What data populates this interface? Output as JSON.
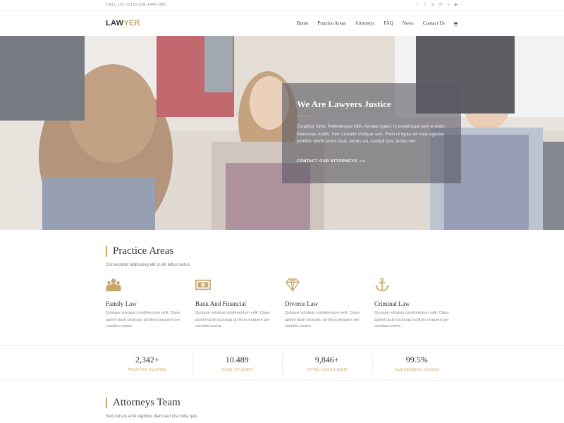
{
  "topbar": {
    "call": "CALL US: (212) 336-1440-356",
    "socials": [
      {
        "icon": "twitter-icon",
        "glyph": "t"
      },
      {
        "icon": "facebook-icon",
        "glyph": "f"
      },
      {
        "icon": "instagram-icon",
        "glyph": "◎"
      },
      {
        "icon": "linkedin-icon",
        "glyph": "in"
      },
      {
        "icon": "skype-icon",
        "glyph": "s"
      },
      {
        "icon": "youtube-icon",
        "glyph": "▶"
      }
    ]
  },
  "header": {
    "logo_part1": "LAW",
    "logo_part2": "YER",
    "nav": [
      "Home",
      "Practice Areas",
      "Attorneys",
      "FAQ",
      "News",
      "Contact Us"
    ],
    "menu_icon": "hamburger-menu-icon"
  },
  "hero": {
    "title": "We Are Lawyers Justice",
    "text": "Curabitur tortor. Pellentesque nibh. Aenean quam. In scelerisque sem at dolor. Maecenas mattis. Sed convallis tristique sem. Proin ut ligula vel nunc egestas porttitor. Morbi lectus risus, iaculis vel, suscipit quis, luctus non.",
    "cta": "CONTACT OUR ATTORNEYS",
    "cta_arrow": "⟶"
  },
  "practice": {
    "title": "Practice Areas",
    "subtitle": "Consectetur adipiscing elit ut elit tellus luctus",
    "items": [
      {
        "icon": "group-icon",
        "title": "Family Law",
        "text": "Quisque volutpat condimentum velit. Class aptent taciti sociosqu ad litora torquent per conubia nostra."
      },
      {
        "icon": "money-icon",
        "title": "Bank And Financial",
        "text": "Quisque volutpat condimentum velit. Class aptent taciti sociosqu ad litora torquent per conubia nostra."
      },
      {
        "icon": "diamond-icon",
        "title": "Divorce Law",
        "text": "Quisque volutpat condimentum velit. Class aptent taciti sociosqu ad litora torquent per conubia nostra."
      },
      {
        "icon": "anchor-icon",
        "title": "Criminal Law",
        "text": "Quisque volutpat condimentum velit. Class aptent taciti sociosqu ad litora torquent per conubia nostra."
      }
    ]
  },
  "stats": [
    {
      "value": "2,342+",
      "label": "TRUSTED CLIENTS"
    },
    {
      "value": "10.489",
      "label": "CASE STUDIES"
    },
    {
      "value": "9,846+",
      "label": "TOTAL CASES WON"
    },
    {
      "value": "99.5%",
      "label": "SUCCESSFUL CASES"
    }
  ],
  "attorneys": {
    "title": "Attorneys Team",
    "subtitle": "Sed cursus ante dapibus diam sed nisi nulla quis"
  },
  "colors": {
    "accent": "#c9a76a",
    "dark_text": "#333333",
    "hero_box": "#5a5a64"
  }
}
